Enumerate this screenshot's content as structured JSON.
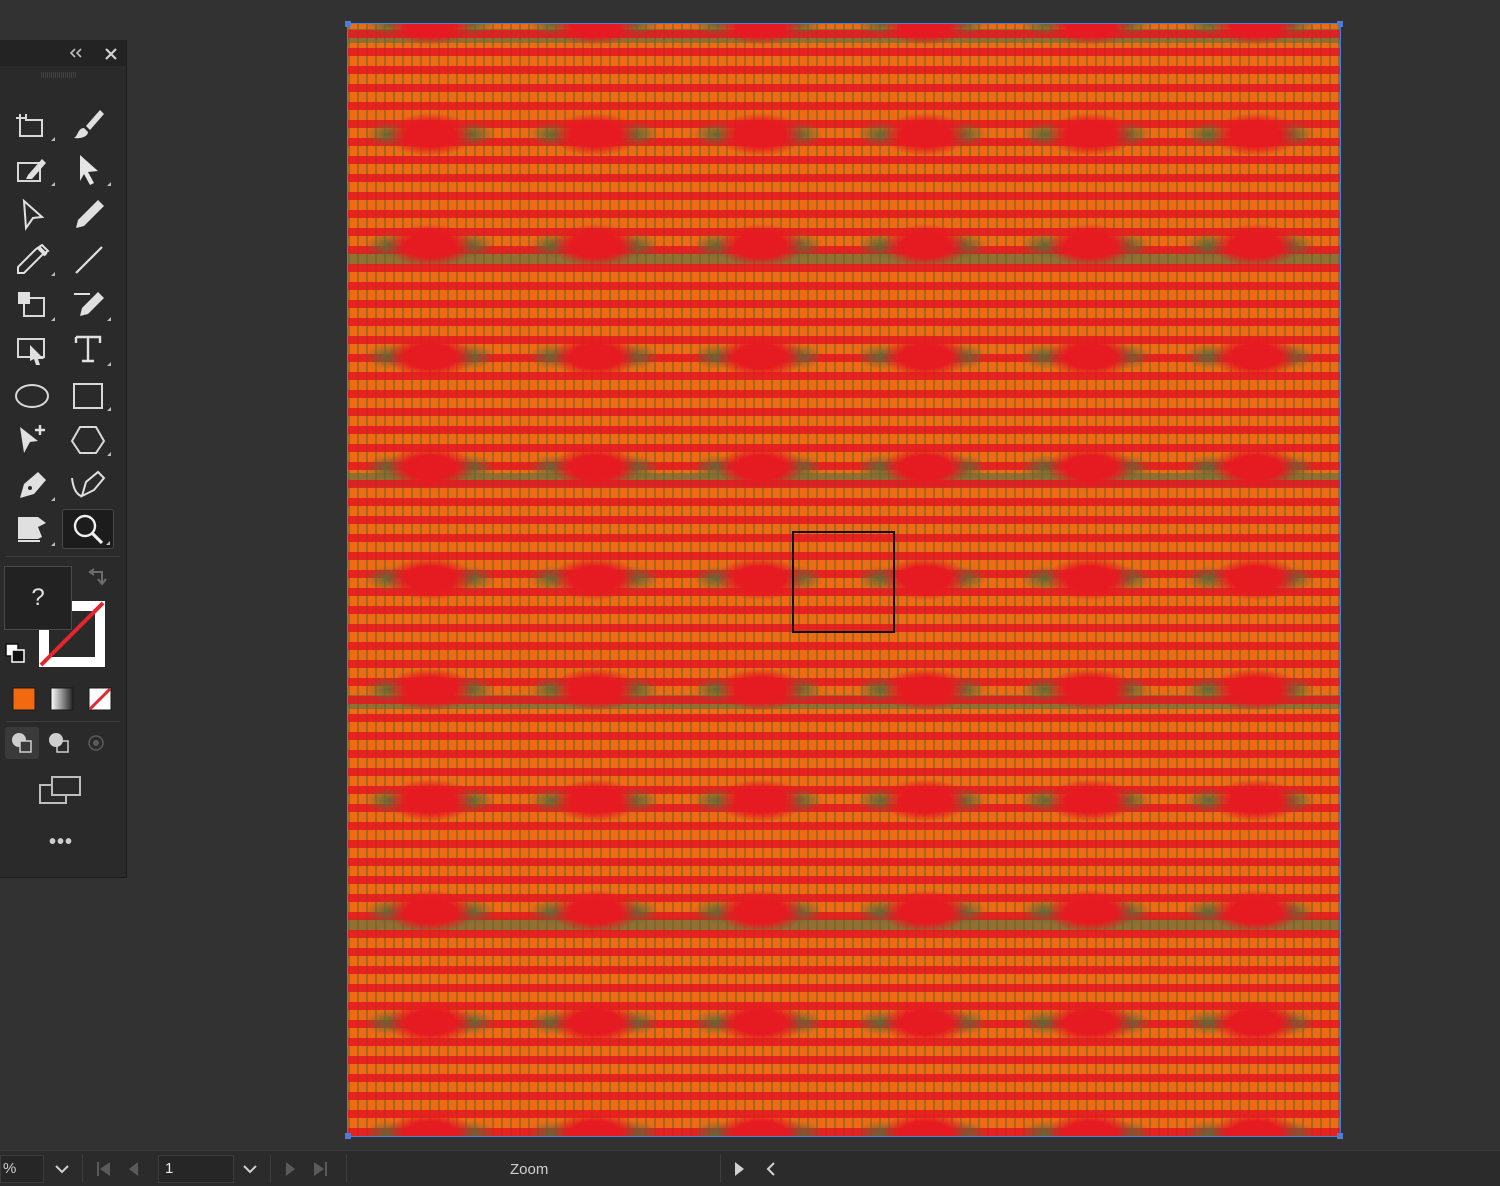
{
  "tools_panel": {
    "fill_swatch_label": "?",
    "more_tools_label": "•••",
    "tools": [
      "artboard-icon",
      "paintbrush-icon",
      "shaper-icon",
      "selection-icon",
      "direct-selection-icon",
      "pencil-icon",
      "eyedropper-icon",
      "line-segment-icon",
      "symbol-sprayer-icon",
      "blob-brush-icon",
      "touch-type-icon",
      "type-icon",
      "ellipse-icon",
      "rectangle-icon",
      "anchor-point-icon",
      "polygon-icon",
      "pen-icon",
      "curvature-icon",
      "free-transform-icon",
      "zoom-icon"
    ],
    "active_tool": "zoom-icon",
    "colors": {
      "color_mode_swatch": "#f26a10",
      "none_slash": "#e3262b"
    }
  },
  "canvas": {
    "pattern_colors": [
      "#f06a12",
      "#e61a21",
      "#5d6a37"
    ]
  },
  "status_bar": {
    "zoom_value": "%",
    "artboard_number": "1",
    "current_tool": "Zoom"
  }
}
